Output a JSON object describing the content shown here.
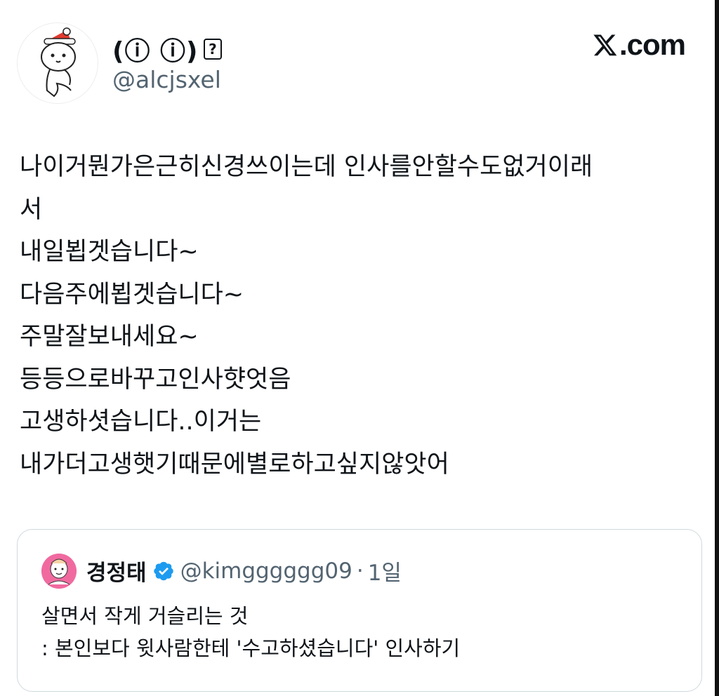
{
  "author": {
    "display_name": "(ⓘ ⓘ)",
    "display_name_emoji": "?",
    "handle": "@alcjsxel",
    "avatar_icon": "santa-hat-cartoon-avatar"
  },
  "brand": {
    "logo_text": ".com",
    "logo_icon": "x-logo-icon"
  },
  "tweet": {
    "lines": [
      "나이거뭔가은근히신경쓰이는데 인사를안할수도없거이래",
      "서",
      "내일뵙겟습니다~",
      "다음주에뵙겟습니다~",
      "주말잘보내세요~",
      "등등으로바꾸고인사햣엇음",
      "고생하셧습니다..이거는",
      "내가더고생햇기때문에별로하고싶지않앗어"
    ]
  },
  "quote": {
    "name": "경정태",
    "handle": "@kimgggggg09",
    "separator": "·",
    "time": "1일",
    "verified_color": "#1d9bf0",
    "lines": [
      "살면서 작게 거슬리는 것",
      ": 본인보다 윗사람한테 '수고하셨습니다' 인사하기"
    ]
  }
}
